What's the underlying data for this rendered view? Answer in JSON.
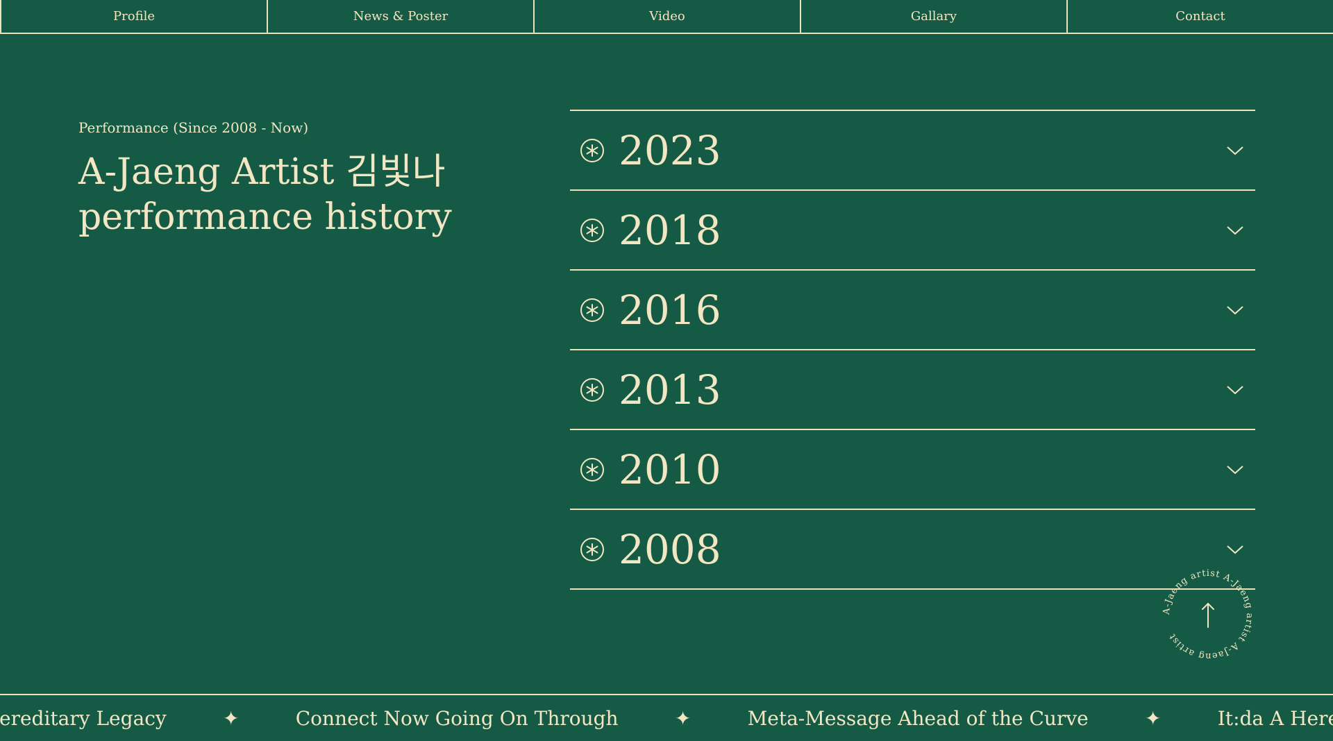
{
  "nav": {
    "items": [
      "Profile",
      "News & Poster",
      "Video",
      "Gallary",
      "Contact"
    ]
  },
  "intro": {
    "kicker": "Performance (Since 2008 - Now)",
    "title_line1": "A-Jaeng Artist 김빛나",
    "title_line2": "performance history"
  },
  "accordion": {
    "years": [
      "2023",
      "2018",
      "2016",
      "2013",
      "2010",
      "2008"
    ]
  },
  "badge": {
    "ring_text": "A-Jaeng artist A-Jaeng artist A-Jaeng artist",
    "icon": "arrow-up-icon"
  },
  "marquee": {
    "items": [
      "ereditary Legacy",
      "Connect Now Going On Through",
      "Meta-Message Ahead of the Curve",
      "It:da A Hereditary Legacy"
    ],
    "separator_icon": "four-point-star-icon"
  },
  "colors": {
    "background": "#145a44",
    "foreground": "#f3e6c4"
  }
}
